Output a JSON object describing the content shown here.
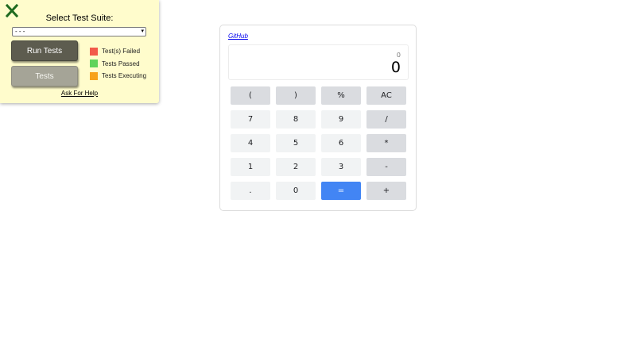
{
  "test_panel": {
    "title": "Select Test Suite:",
    "suite_select_value": "- - -",
    "run_tests_label": "Run Tests",
    "tests_label": "Tests",
    "legend": [
      {
        "label": "Test(s) Failed",
        "color": "#f25a4a"
      },
      {
        "label": "Tests Passed",
        "color": "#5fd35b"
      },
      {
        "label": "Tests Executing",
        "color": "#f7a21b"
      }
    ],
    "help_label": "Ask For Help",
    "close_icon_color": "#1f6a1f"
  },
  "calculator": {
    "github_label": "GitHub",
    "display_expression": "0",
    "display_result": "0",
    "keys": [
      [
        "(",
        ")",
        "%",
        "AC"
      ],
      [
        "7",
        "8",
        "9",
        "/"
      ],
      [
        "4",
        "5",
        "6",
        "*"
      ],
      [
        "1",
        "2",
        "3",
        "-"
      ],
      [
        ".",
        "0",
        "=",
        "+"
      ]
    ],
    "colors": {
      "number_key": "#f1f3f4",
      "operator_key": "#dadce0",
      "equals_key": "#4285f4"
    }
  }
}
